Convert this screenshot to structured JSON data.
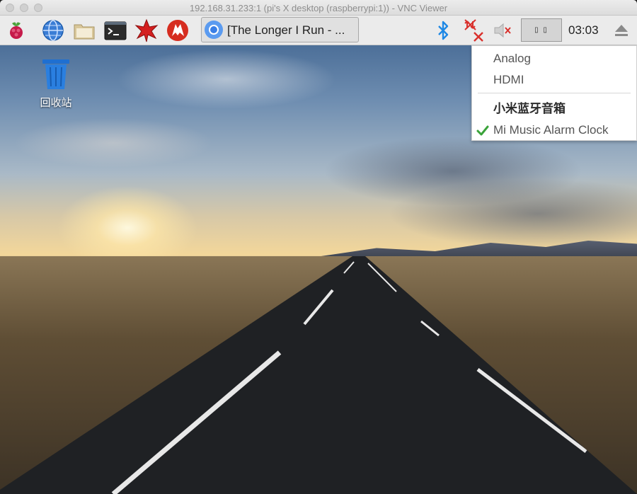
{
  "window": {
    "title": "192.168.31.233:1 (pi's X desktop (raspberrypi:1)) - VNC Viewer"
  },
  "taskbar": {
    "launchers": [
      {
        "icon": "raspberry-menu-icon"
      },
      {
        "icon": "web-browser-icon"
      },
      {
        "icon": "file-manager-icon"
      },
      {
        "icon": "terminal-icon"
      },
      {
        "icon": "mathematica-icon"
      },
      {
        "icon": "wolfram-icon"
      }
    ],
    "task": {
      "icon": "chromium-icon",
      "label": "[The Longer I Run - ..."
    },
    "tray": {
      "bluetooth_icon": "bluetooth-icon",
      "network_icon": "network-disconnected-icon",
      "volume_icon": "volume-muted-icon",
      "cpu_text": "▯ ▯",
      "clock": "03:03",
      "eject_icon": "eject-icon"
    }
  },
  "desktop": {
    "icons": [
      {
        "icon": "trash-icon",
        "label": "回收站"
      }
    ]
  },
  "audio_menu": {
    "items": [
      {
        "label": "Analog",
        "checked": false,
        "bold": false
      },
      {
        "label": "HDMI",
        "checked": false,
        "bold": false
      },
      {
        "label": "小米蓝牙音箱",
        "checked": false,
        "bold": true
      },
      {
        "label": "Mi Music Alarm Clock",
        "checked": true,
        "bold": false
      }
    ]
  },
  "colors": {
    "taskbar_bg": "#ebebeb",
    "menu_bg": "#ffffff",
    "check_green": "#3aa33a",
    "bluetooth_blue": "#1e88e5",
    "network_red": "#d9302c"
  }
}
